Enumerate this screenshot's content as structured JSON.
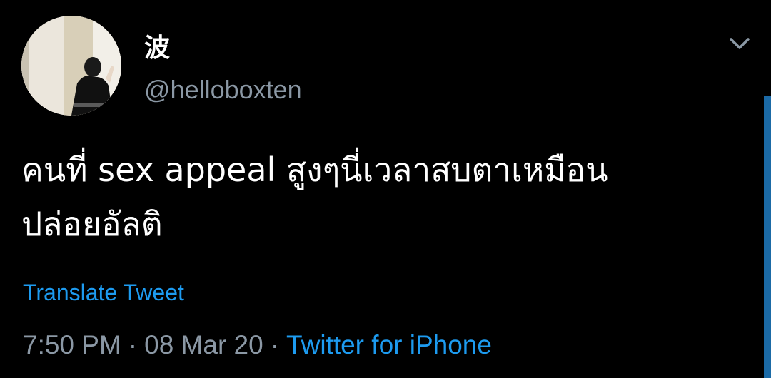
{
  "tweet": {
    "display_name": "波",
    "handle": "@helloboxten",
    "text": "คนที่ sex appeal สูงๆนี่เวลาสบตาเหมือน\nปล่อยอัลติ",
    "translate_label": "Translate Tweet",
    "time": "7:50 PM",
    "date": "08 Mar 20",
    "separator": "·",
    "source": "Twitter for iPhone"
  },
  "icons": {
    "menu": "chevron-down-icon",
    "avatar": "avatar-photo"
  },
  "colors": {
    "background": "#000000",
    "text": "#ffffff",
    "secondary": "#8b98a5",
    "accent": "#1d9bf0"
  }
}
